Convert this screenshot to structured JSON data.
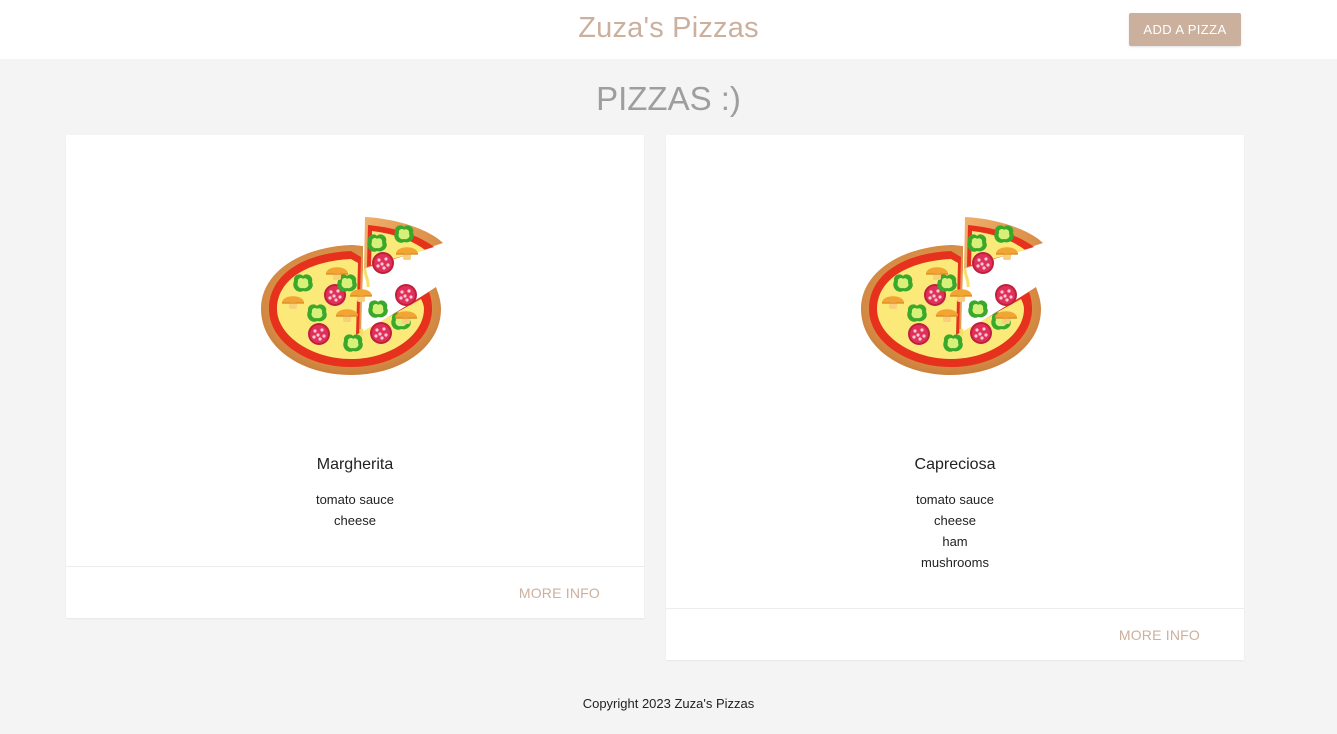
{
  "header": {
    "brand": "Zuza's Pizzas",
    "add_button_label": "ADD A PIZZA"
  },
  "main": {
    "title": "PIZZAS :)",
    "cards": [
      {
        "name": "Margherita",
        "image_icon": "pizza-icon",
        "ingredients": [
          "tomato sauce",
          "cheese"
        ],
        "action_label": "MORE INFO"
      },
      {
        "name": "Capreciosa",
        "image_icon": "pizza-icon",
        "ingredients": [
          "tomato sauce",
          "cheese",
          "ham",
          "mushrooms"
        ],
        "action_label": "MORE INFO"
      }
    ]
  },
  "footer": {
    "copyright": "Copyright 2023 Zuza's Pizzas"
  },
  "colors": {
    "accent": "#cbb09e",
    "background": "#f4f4f4",
    "card": "#ffffff",
    "title_grey": "#9e9e9e"
  }
}
